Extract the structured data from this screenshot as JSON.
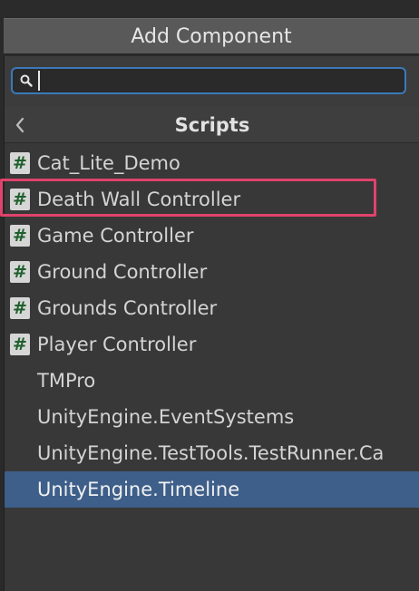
{
  "add_component": {
    "label": "Add Component"
  },
  "search": {
    "value": "",
    "icon": "search-icon"
  },
  "header": {
    "title": "Scripts",
    "back_icon": "chevron-left-icon"
  },
  "items": [
    {
      "label": "Cat_Lite_Demo",
      "icon": "script-hash-icon",
      "selected": false
    },
    {
      "label": "Death Wall Controller",
      "icon": "script-hash-icon",
      "selected": false,
      "highlighted": true
    },
    {
      "label": "Game Controller",
      "icon": "script-hash-icon",
      "selected": false
    },
    {
      "label": "Ground Controller",
      "icon": "script-hash-icon",
      "selected": false
    },
    {
      "label": "Grounds Controller",
      "icon": "script-hash-icon",
      "selected": false
    },
    {
      "label": "Player Controller",
      "icon": "script-hash-icon",
      "selected": false
    },
    {
      "label": "TMPro",
      "icon": "",
      "selected": false
    },
    {
      "label": "UnityEngine.EventSystems",
      "icon": "",
      "selected": false
    },
    {
      "label": "UnityEngine.TestTools.TestRunner.Ca",
      "icon": "",
      "selected": false
    },
    {
      "label": "UnityEngine.Timeline",
      "icon": "",
      "selected": true
    }
  ],
  "hash_glyph": "#",
  "colors": {
    "selection": "#3e5f8a",
    "highlight_border": "#e0436c",
    "search_border": "#3a79bb",
    "script_icon_fg": "#1f5f2c"
  }
}
